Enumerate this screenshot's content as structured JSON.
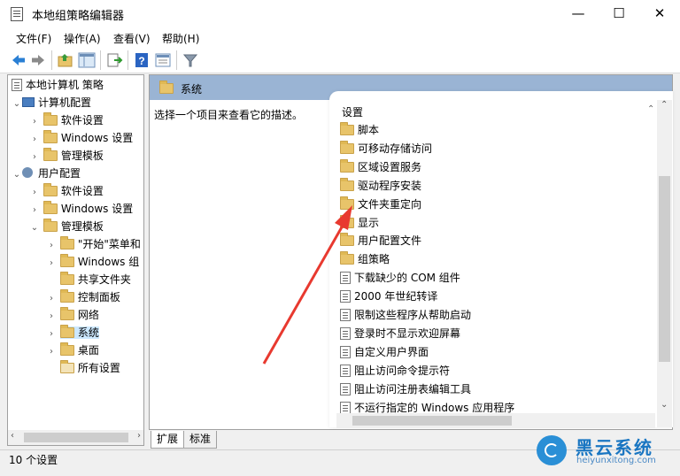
{
  "window": {
    "title": "本地组策略编辑器",
    "min": "—",
    "max": "☐",
    "close": "✕"
  },
  "menu": [
    "文件(F)",
    "操作(A)",
    "查看(V)",
    "帮助(H)"
  ],
  "toolbar_icons": [
    "back-arrow-icon",
    "forward-arrow-icon",
    "up-folder-icon",
    "show-hide-tree-icon",
    "export-list-icon",
    "help-icon",
    "properties-icon",
    "filter-icon"
  ],
  "tree": {
    "root": "本地计算机 策略",
    "computer_config": "计算机配置",
    "c_software": "软件设置",
    "c_windows": "Windows 设置",
    "c_templates": "管理模板",
    "user_config": "用户配置",
    "u_software": "软件设置",
    "u_windows": "Windows 设置",
    "u_templates": "管理模板",
    "start_menu": "\"开始\"菜单和",
    "windows_comp": "Windows 组",
    "shared_folders": "共享文件夹",
    "control_panel": "控制面板",
    "network": "网络",
    "system": "系统",
    "desktop": "桌面",
    "all_settings": "所有设置"
  },
  "right": {
    "header": "系统",
    "description": "选择一个项目来查看它的描述。",
    "column": "设置",
    "items": [
      {
        "label": "脚本",
        "type": "folder"
      },
      {
        "label": "可移动存储访问",
        "type": "folder"
      },
      {
        "label": "区域设置服务",
        "type": "folder"
      },
      {
        "label": "驱动程序安装",
        "type": "folder"
      },
      {
        "label": "文件夹重定向",
        "type": "folder"
      },
      {
        "label": "显示",
        "type": "folder"
      },
      {
        "label": "用户配置文件",
        "type": "folder"
      },
      {
        "label": "组策略",
        "type": "folder"
      },
      {
        "label": "下载缺少的 COM 组件",
        "type": "setting"
      },
      {
        "label": "2000 年世纪转译",
        "type": "setting"
      },
      {
        "label": "限制这些程序从帮助启动",
        "type": "setting"
      },
      {
        "label": "登录时不显示欢迎屏幕",
        "type": "setting"
      },
      {
        "label": "自定义用户界面",
        "type": "setting"
      },
      {
        "label": "阻止访问命令提示符",
        "type": "setting"
      },
      {
        "label": "阻止访问注册表编辑工具",
        "type": "setting"
      },
      {
        "label": "不运行指定的 Windows 应用程序",
        "type": "setting"
      }
    ]
  },
  "tabs": [
    "扩展",
    "标准"
  ],
  "status": "10 个设置",
  "watermark": {
    "name": "黑云系统",
    "url": "heiyunxitong.com"
  },
  "colors": {
    "header": "#9ab4d4",
    "selection": "#cce8ff",
    "arrow": "#e8392f",
    "watermark": "#1a76c2"
  }
}
